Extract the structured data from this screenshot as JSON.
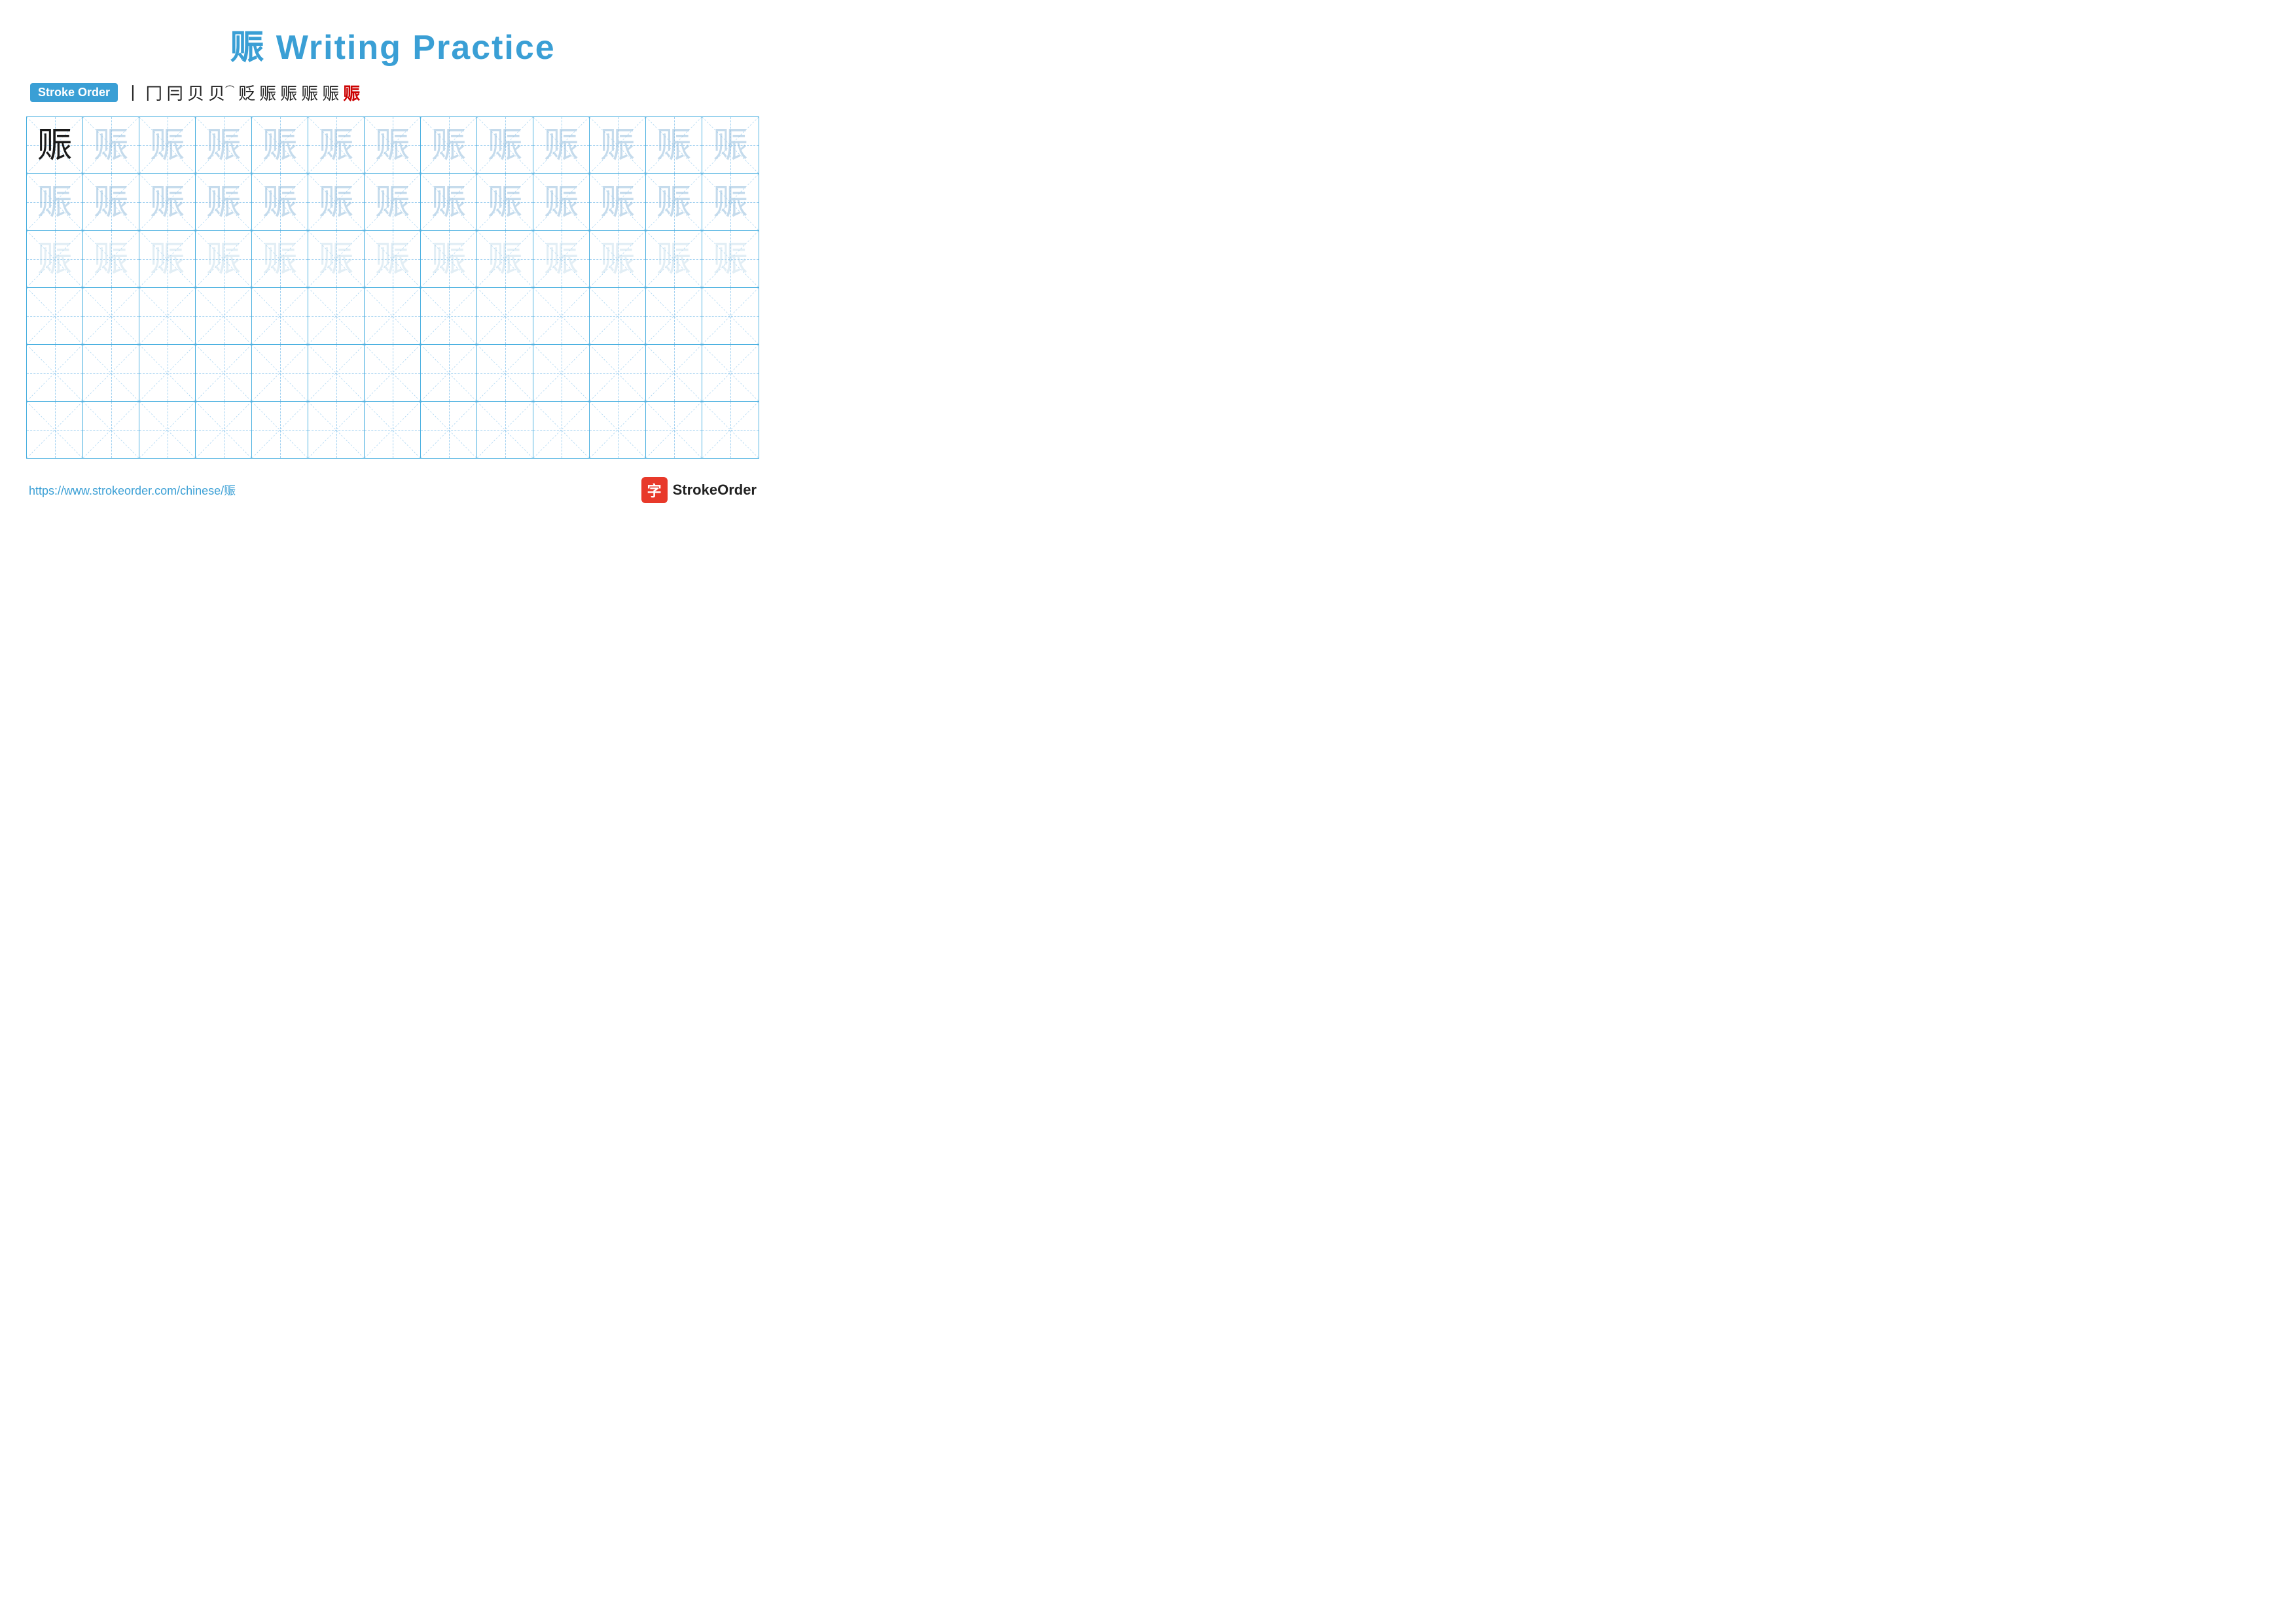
{
  "title": "赈 Writing Practice",
  "stroke_order": {
    "badge_label": "Stroke Order",
    "strokes": [
      "丨",
      "冂",
      "冃",
      "贝",
      "贝⁻",
      "贬",
      "贬",
      "赈",
      "赈",
      "赈",
      "赈"
    ]
  },
  "character": "赈",
  "grid": {
    "rows": 6,
    "cols": 13,
    "row_types": [
      "solid-then-light",
      "light",
      "lighter",
      "empty",
      "empty",
      "empty"
    ]
  },
  "footer": {
    "url": "https://www.strokeorder.com/chinese/赈",
    "logo_text": "StrokeOrder",
    "logo_char": "字"
  }
}
